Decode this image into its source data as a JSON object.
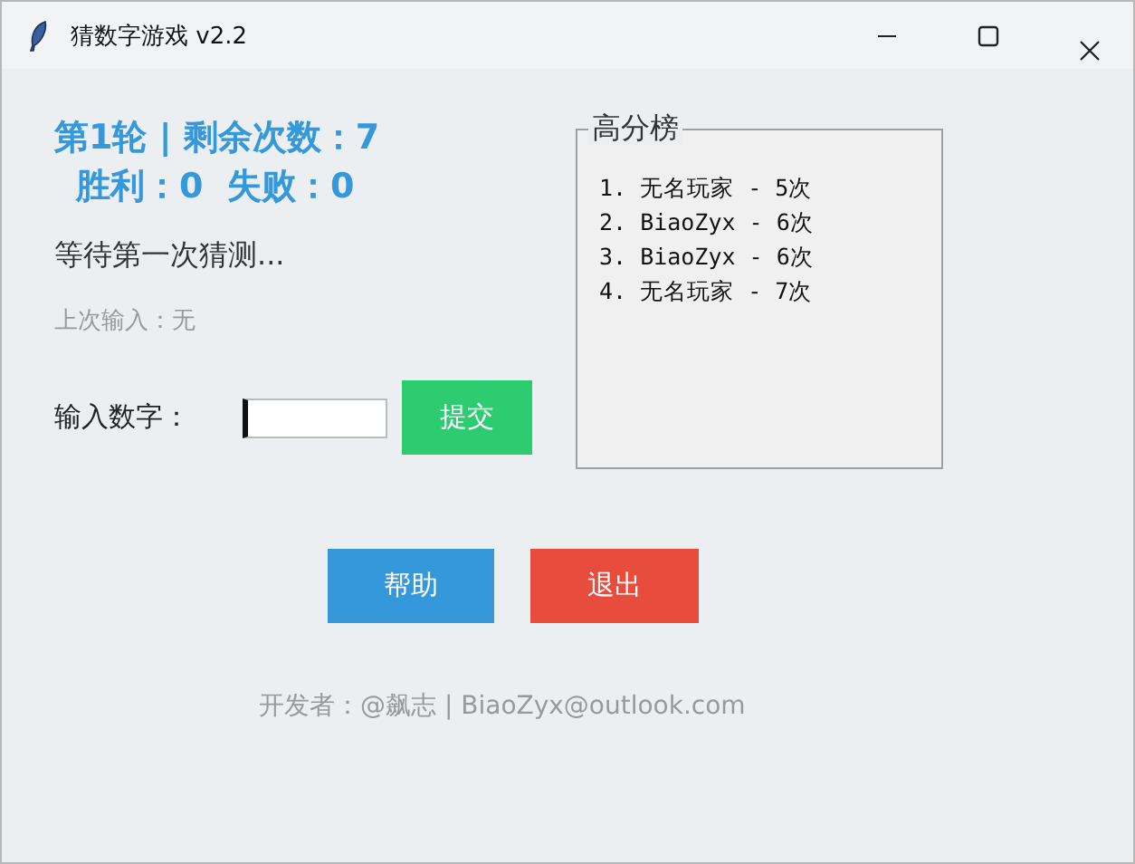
{
  "window": {
    "title": "猜数字游戏 v2.2"
  },
  "stats": {
    "round_line": "第1轮 | 剩余次数：7",
    "score_line": "胜利：0  失败：0"
  },
  "status": "等待第一次猜测...",
  "last_input": "上次输入：无",
  "input": {
    "label": "输入数字："
  },
  "submit_button": "提交",
  "leaderboard": {
    "title": "高分榜",
    "entries": [
      "1. 无名玩家 - 5次",
      "2. BiaoZyx - 6次",
      "3. BiaoZyx - 6次",
      "4. 无名玩家 - 7次"
    ]
  },
  "buttons": [
    {
      "label": "帮助",
      "kind": "help"
    },
    {
      "label": "退出",
      "kind": "exit"
    }
  ],
  "footer": "开发者：@飙志 | BiaoZyx@outlook.com"
}
